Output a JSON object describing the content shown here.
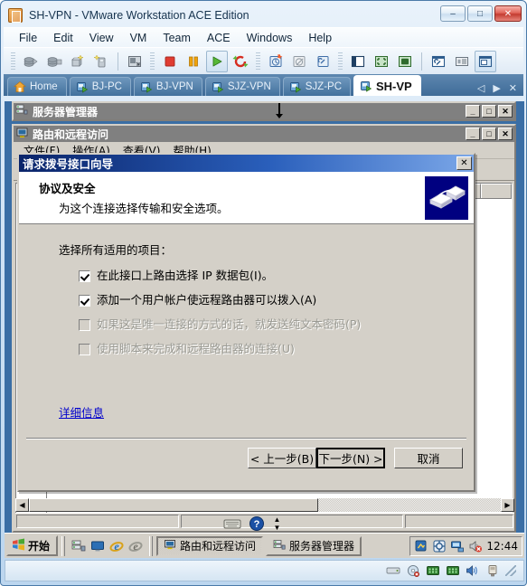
{
  "vmware": {
    "title": "SH-VPN - VMware Workstation ACE Edition",
    "title_icon": "vmware-logo-icon",
    "window_buttons": [
      {
        "name": "minimize-button",
        "glyph": "–"
      },
      {
        "name": "maximize-button",
        "glyph": "□"
      },
      {
        "name": "close-button",
        "glyph": "✕"
      }
    ],
    "menus": [
      "File",
      "Edit",
      "View",
      "VM",
      "Team",
      "ACE",
      "Windows",
      "Help"
    ],
    "toolbar_groups": [
      {
        "buttons": [
          {
            "name": "power-on-team-icon",
            "glyph": "⛁",
            "active": false
          },
          {
            "name": "power-off-team-icon",
            "glyph": "⛁",
            "active": false
          },
          {
            "name": "new-virtual-machine-icon",
            "glyph": "⬛",
            "active": false
          },
          {
            "name": "new-team-icon",
            "glyph": "⬛",
            "active": false
          }
        ]
      },
      {
        "buttons": [
          {
            "name": "snapshot-manager-icon",
            "glyph": "▤",
            "active": false
          }
        ]
      },
      {
        "buttons": [
          {
            "name": "power-off-icon",
            "glyph": "■",
            "active": false
          },
          {
            "name": "suspend-icon",
            "glyph": "‖",
            "active": false
          },
          {
            "name": "power-on-icon",
            "glyph": "▶",
            "active": true
          },
          {
            "name": "reset-icon",
            "glyph": "↻",
            "active": false
          }
        ]
      },
      {
        "buttons": [
          {
            "name": "take-snapshot-icon",
            "glyph": "⏱",
            "active": false
          },
          {
            "name": "revert-snapshot-icon",
            "glyph": "↺",
            "active": false
          },
          {
            "name": "manage-snapshots-icon",
            "glyph": "⚒",
            "active": false
          }
        ]
      },
      {
        "buttons": [
          {
            "name": "show-sidebar-icon",
            "glyph": "▥",
            "active": false
          },
          {
            "name": "fit-guest-icon",
            "glyph": "⛶",
            "active": false
          },
          {
            "name": "full-screen-icon",
            "glyph": "▣",
            "active": false
          }
        ]
      },
      {
        "buttons": [
          {
            "name": "vm-settings-icon",
            "glyph": "🔧",
            "active": false
          },
          {
            "name": "summary-view-icon",
            "glyph": "≣",
            "active": false
          },
          {
            "name": "console-view-icon",
            "glyph": "▧",
            "active": true
          }
        ]
      }
    ],
    "tabs": [
      {
        "label": "Home",
        "icon": "home-icon",
        "active": false
      },
      {
        "label": "BJ-PC",
        "icon": "vm-icon",
        "active": false
      },
      {
        "label": "BJ-VPN",
        "icon": "vm-icon",
        "active": false
      },
      {
        "label": "SJZ-VPN",
        "icon": "vm-icon",
        "active": false
      },
      {
        "label": "SJZ-PC",
        "icon": "vm-icon",
        "active": false
      },
      {
        "label": "SH-VP",
        "icon": "vm-icon",
        "active": true
      }
    ],
    "tab_nav": [
      {
        "name": "tab-scroll-left",
        "glyph": "◁"
      },
      {
        "name": "tab-scroll-right",
        "glyph": "▶"
      },
      {
        "name": "tab-close",
        "glyph": "✕"
      }
    ]
  },
  "server_manager_window": {
    "title": "服务器管理器",
    "icon": "server-manager-icon",
    "buttons": [
      {
        "name": "minimize-button",
        "glyph": "_"
      },
      {
        "name": "maximize-button",
        "glyph": "□"
      },
      {
        "name": "close-button",
        "glyph": "✕"
      }
    ]
  },
  "rras_window": {
    "title": "路由和远程访问",
    "icon": "rras-icon",
    "buttons": [
      {
        "name": "minimize-button",
        "glyph": "_"
      },
      {
        "name": "maximize-button",
        "glyph": "□"
      },
      {
        "name": "close-button",
        "glyph": "✕"
      }
    ],
    "menus": [
      "文件(F)",
      "操作(A)",
      "查看(V)",
      "帮助(H)"
    ],
    "toolbar": [
      {
        "name": "back-icon",
        "glyph": "⬅"
      }
    ],
    "tree_nodes": [
      {
        "name": "server-node-icon",
        "glyph": "🖥"
      },
      {
        "name": "expand-node-icon",
        "glyph": "−"
      }
    ],
    "list_columns": [
      "",
      ""
    ],
    "list_rows": [
      "",
      "",
      "",
      "",
      "",
      ""
    ]
  },
  "wizard": {
    "title": "请求拨号接口向导",
    "close_glyph": "✕",
    "header_title": "协议及安全",
    "header_subtitle": "为这个连接选择传输和安全选项。",
    "header_icon": "network-connection-icon",
    "prompt": "选择所有适用的项目：",
    "options": [
      {
        "label": "在此接口上路由选择 IP 数据包(I)。",
        "checked": true,
        "enabled": true
      },
      {
        "label": "添加一个用户帐户使远程路由器可以拨入(A)",
        "checked": true,
        "enabled": true
      },
      {
        "label": "如果这是唯一连接的方式的话，就发送纯文本密码(P)",
        "checked": false,
        "enabled": false
      },
      {
        "label": "使用脚本来完成和远程路由器的连接(U)",
        "checked": false,
        "enabled": false
      }
    ],
    "link_text": "详细信息",
    "buttons": [
      {
        "name": "back-button",
        "label": "< 上一步(B)",
        "default": false
      },
      {
        "name": "next-button",
        "label": "下一步(N) >",
        "default": true
      },
      {
        "name": "cancel-button",
        "label": "取消",
        "default": false
      }
    ]
  },
  "taskbar": {
    "start_label": "开始",
    "start_icon": "windows-flag-icon",
    "quick_launch": [
      {
        "name": "server-manager-quicklaunch-icon",
        "glyph": "▤"
      },
      {
        "name": "show-desktop-icon",
        "glyph": "🖥"
      },
      {
        "name": "internet-explorer-icon",
        "glyph": "e"
      },
      {
        "name": "internet-explorer-alt-icon",
        "glyph": "e"
      }
    ],
    "tasks": [
      {
        "label": "路由和远程访问",
        "icon": "rras-icon",
        "active": true
      },
      {
        "label": "服务器管理器",
        "icon": "server-manager-icon",
        "active": false
      }
    ],
    "tray_icons": [
      {
        "name": "network-config-tray-icon",
        "glyph": "🖼"
      },
      {
        "name": "vmware-tools-tray-icon",
        "glyph": "⚙"
      },
      {
        "name": "network-tray-icon",
        "glyph": "🖥"
      },
      {
        "name": "volume-muted-tray-icon",
        "glyph": "🔊"
      }
    ],
    "clock": "12:44"
  },
  "vmware_status": {
    "icons": [
      {
        "name": "hard-disk-status-icon",
        "glyph": "▭"
      },
      {
        "name": "cd-rom-status-icon",
        "glyph": "◎"
      },
      {
        "name": "network-adapter-1-status-icon",
        "glyph": "⬛"
      },
      {
        "name": "network-adapter-2-status-icon",
        "glyph": "⬛"
      },
      {
        "name": "sound-status-icon",
        "glyph": "🔊"
      },
      {
        "name": "usb-status-icon",
        "glyph": "⚡"
      }
    ]
  },
  "colors": {
    "vmware_chrome": "#bcd6ef",
    "classic_face": "#d4d0c8",
    "dialog_title": "#0a246a",
    "inactive_title": "#808080",
    "link": "#0000cc",
    "guest_desktop": "#3a6ea5"
  }
}
